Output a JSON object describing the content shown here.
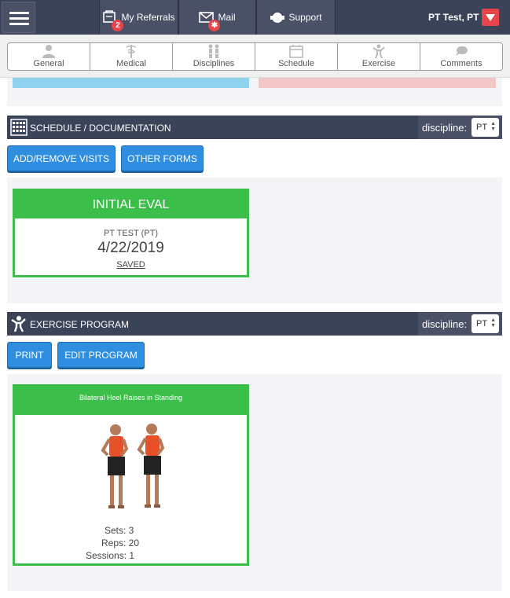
{
  "header": {
    "nav": [
      {
        "label": "My Referrals",
        "badge": "2",
        "icon": "referrals-icon"
      },
      {
        "label": "Mail",
        "badge": "✱",
        "icon": "mail-icon"
      },
      {
        "label": "Support",
        "icon": "support-icon"
      }
    ],
    "user_name": "PT Test, PT",
    "colors": {
      "bar": "#3b4358",
      "accent": "#e8454b"
    }
  },
  "subnav": {
    "items": [
      {
        "label": "General",
        "icon": "person-icon"
      },
      {
        "label": "Medical",
        "icon": "caduceus-icon"
      },
      {
        "label": "Disciplines",
        "icon": "people-icon"
      },
      {
        "label": "Schedule",
        "icon": "calendar-icon"
      },
      {
        "label": "Exercise",
        "icon": "exercise-icon"
      },
      {
        "label": "Comments",
        "icon": "chat-icon"
      }
    ]
  },
  "schedule": {
    "title": "SCHEDULE / DOCUMENTATION",
    "discipline_label": "discipline:",
    "discipline_value": "PT",
    "buttons": {
      "add_remove": "ADD/REMOVE VISITS",
      "other_forms": "OTHER FORMS"
    },
    "visit": {
      "type": "INITIAL EVAL",
      "clinician": "PT TEST (PT)",
      "date": "4/22/2019",
      "status": "SAVED"
    }
  },
  "exercise": {
    "title": "EXERCISE PROGRAM",
    "discipline_label": "discipline:",
    "discipline_value": "PT",
    "buttons": {
      "print": "PRINT",
      "edit": "EDIT PROGRAM"
    },
    "item": {
      "name": "Bilateral Heel Raises in Standing",
      "sets": "Sets: 3",
      "reps": "Reps: 20",
      "sessions": "Sessions: 1"
    }
  },
  "colors": {
    "green": "#3cbf4a",
    "button_blue": "#2f8ee0"
  }
}
